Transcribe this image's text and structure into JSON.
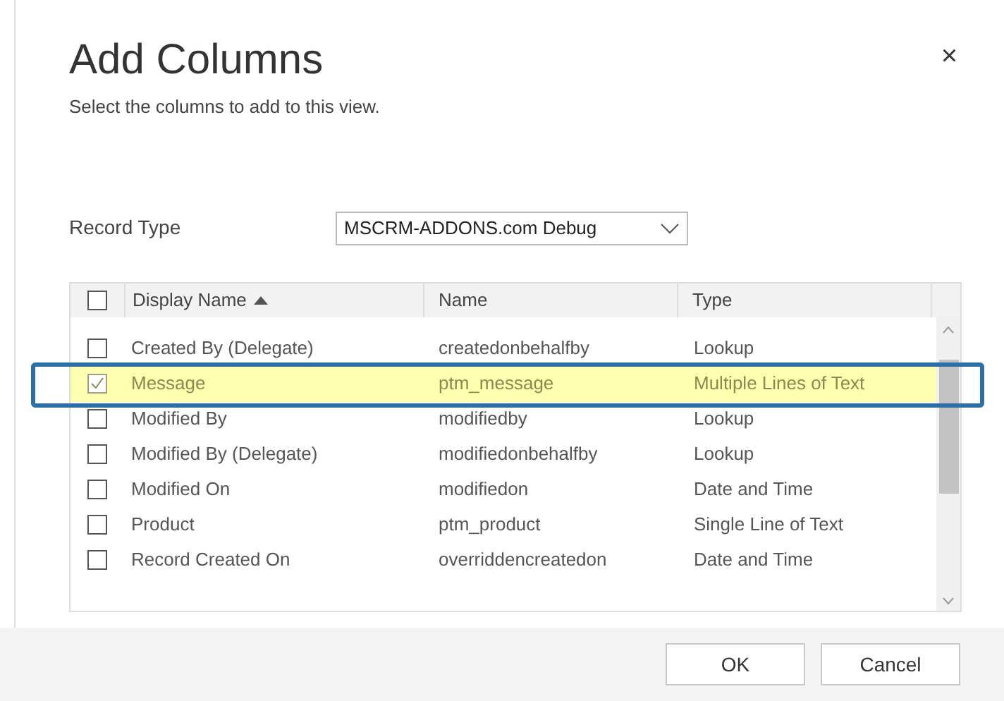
{
  "dialog": {
    "title": "Add Columns",
    "subtitle": "Select the columns to add to this view.",
    "close": "×"
  },
  "record_type": {
    "label": "Record Type",
    "value": "MSCRM-ADDONS.com Debug"
  },
  "table": {
    "select_all_checked": false,
    "columns": [
      {
        "label": "Display Name",
        "sorted": true
      },
      {
        "label": "Name",
        "sorted": false
      },
      {
        "label": "Type",
        "sorted": false
      }
    ],
    "rows": [
      {
        "display_name": "Created By (Delegate)",
        "name": "createdonbehalfby",
        "type": "Lookup",
        "checked": false,
        "selected": false
      },
      {
        "display_name": "Message",
        "name": "ptm_message",
        "type": "Multiple Lines of Text",
        "checked": true,
        "selected": true
      },
      {
        "display_name": "Modified By",
        "name": "modifiedby",
        "type": "Lookup",
        "checked": false,
        "selected": false
      },
      {
        "display_name": "Modified By (Delegate)",
        "name": "modifiedonbehalfby",
        "type": "Lookup",
        "checked": false,
        "selected": false
      },
      {
        "display_name": "Modified On",
        "name": "modifiedon",
        "type": "Date and Time",
        "checked": false,
        "selected": false
      },
      {
        "display_name": "Product",
        "name": "ptm_product",
        "type": "Single Line of Text",
        "checked": false,
        "selected": false
      },
      {
        "display_name": "Record Created On",
        "name": "overriddencreatedon",
        "type": "Date and Time",
        "checked": false,
        "selected": false
      }
    ]
  },
  "buttons": [
    "OK",
    "Cancel"
  ]
}
